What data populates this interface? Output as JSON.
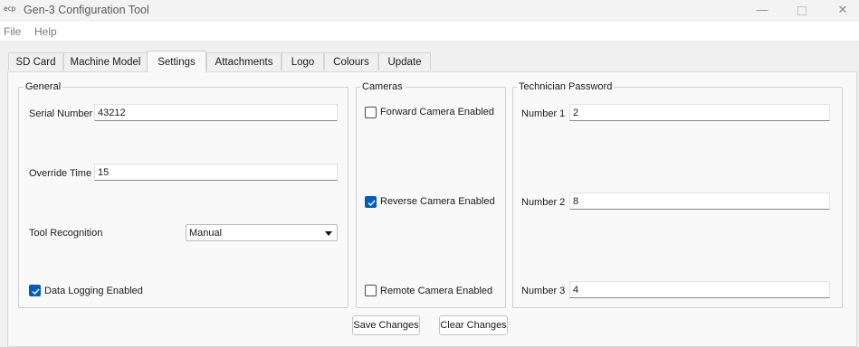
{
  "window": {
    "icon_text": "ecp",
    "title": "Gen-3 Configuration Tool",
    "minimize_glyph": "—",
    "close_glyph": "✕"
  },
  "menu": {
    "file": "File",
    "help": "Help"
  },
  "tabs": [
    {
      "label": "SD Card"
    },
    {
      "label": "Machine Model"
    },
    {
      "label": "Settings",
      "active": true
    },
    {
      "label": "Attachments"
    },
    {
      "label": "Logo"
    },
    {
      "label": "Colours"
    },
    {
      "label": "Update"
    }
  ],
  "general": {
    "title": "General",
    "serial_number": {
      "label": "Serial Number",
      "value": "43212"
    },
    "override_time": {
      "label": "Override Time",
      "value": "15"
    },
    "tool_recognition": {
      "label": "Tool Recognition",
      "selected": "Manual"
    },
    "data_logging": {
      "label": "Data Logging Enabled",
      "checked": true
    }
  },
  "cameras": {
    "title": "Cameras",
    "forward": {
      "label": "Forward Camera Enabled",
      "checked": false
    },
    "reverse": {
      "label": "Reverse Camera Enabled",
      "checked": true
    },
    "remote": {
      "label": "Remote Camera Enabled",
      "checked": false
    }
  },
  "technician_password": {
    "title": "Technician Password",
    "number1": {
      "label": "Number 1",
      "value": "2"
    },
    "number2": {
      "label": "Number 2",
      "value": "8"
    },
    "number3": {
      "label": "Number 3",
      "value": "4"
    }
  },
  "actions": {
    "save": "Save Changes",
    "clear": "Clear Changes"
  },
  "colors": {
    "accent": "#005fb8",
    "panel": "#f9f9f9",
    "window": "#f0f0f0"
  }
}
